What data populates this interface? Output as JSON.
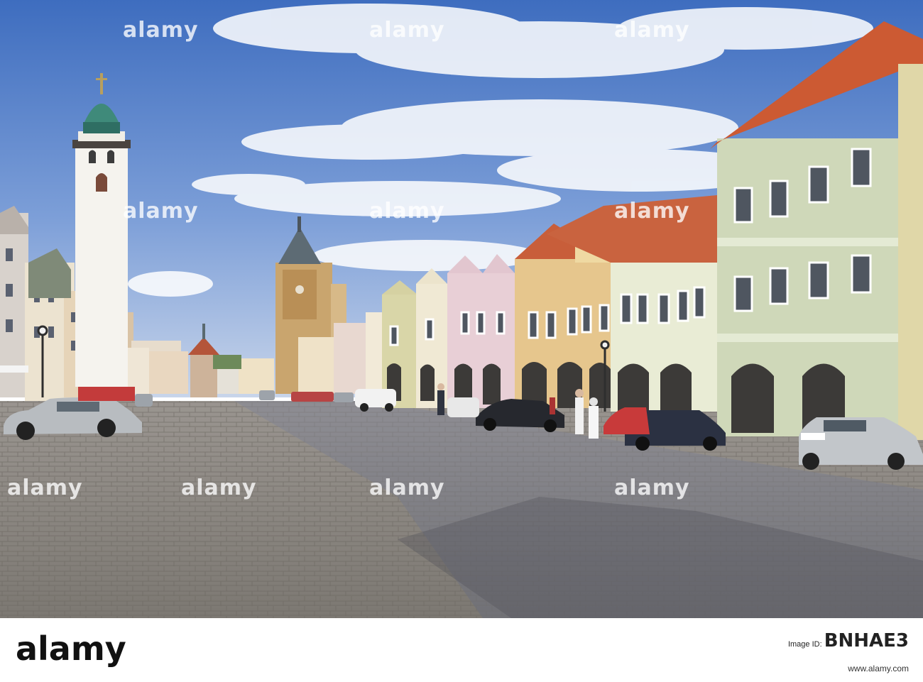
{
  "photo": {
    "subject": "",
    "watermark": "alamy"
  },
  "footer": {
    "brand": "alamy",
    "image_id_label": "Image ID:",
    "image_id": "BNHAE3",
    "url": "www.alamy.com"
  }
}
